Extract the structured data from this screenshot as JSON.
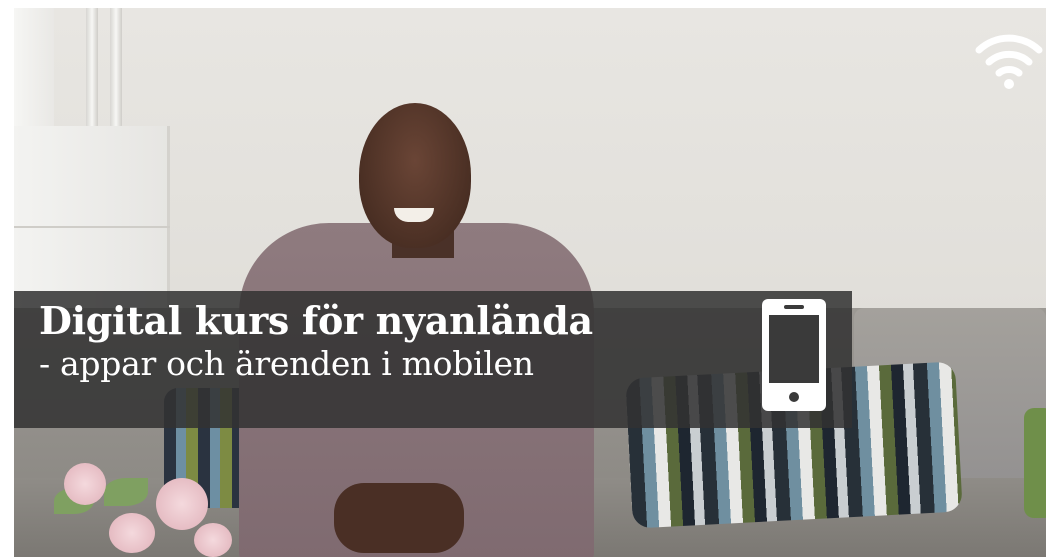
{
  "overlay": {
    "title": "Digital kurs för nyanlända",
    "subtitle": "- appar och ärenden i mobilen",
    "banner_color": "#333333",
    "text_color": "#ffffff"
  },
  "icons": {
    "corner": "wifi-icon",
    "banner": "mobile-phone-icon"
  }
}
